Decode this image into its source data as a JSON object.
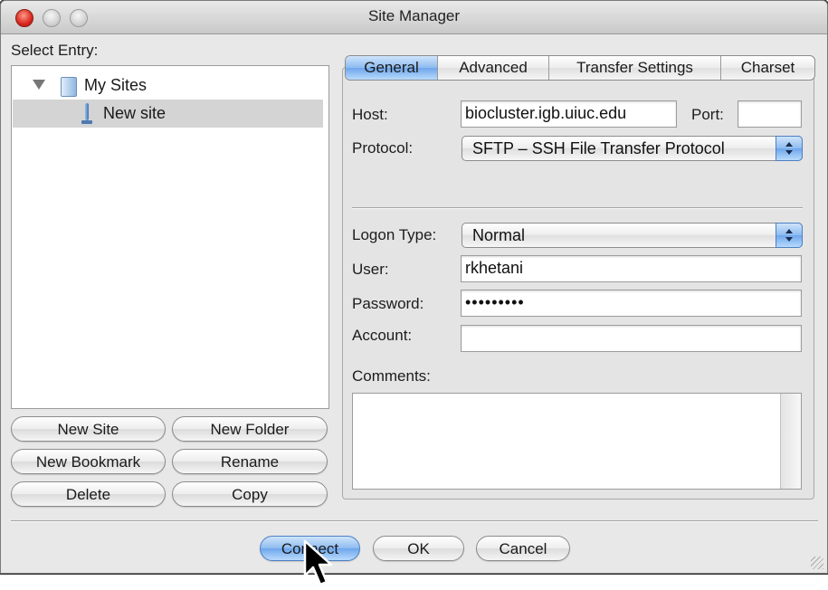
{
  "window": {
    "title": "Site Manager"
  },
  "left": {
    "select_entry_label": "Select Entry:",
    "tree": [
      {
        "label": "My Sites",
        "type": "folder",
        "expanded": true,
        "icon": "folder-icon"
      },
      {
        "label": "New site",
        "type": "site",
        "selected": true,
        "icon": "site-icon"
      }
    ],
    "buttons": {
      "new_site": "New Site",
      "new_folder": "New Folder",
      "new_bookmark": "New Bookmark",
      "rename": "Rename",
      "delete": "Delete",
      "copy": "Copy"
    }
  },
  "tabs": [
    {
      "label": "General",
      "active": true
    },
    {
      "label": "Advanced",
      "active": false
    },
    {
      "label": "Transfer Settings",
      "active": false
    },
    {
      "label": "Charset",
      "active": false
    }
  ],
  "general": {
    "host_label": "Host:",
    "host_value": "biocluster.igb.uiuc.edu",
    "port_label": "Port:",
    "port_value": "",
    "protocol_label": "Protocol:",
    "protocol_value": "SFTP – SSH File Transfer Protocol",
    "logon_type_label": "Logon Type:",
    "logon_type_value": "Normal",
    "user_label": "User:",
    "user_value": "rkhetani",
    "password_label": "Password:",
    "password_value": "•••••••••",
    "account_label": "Account:",
    "account_value": "",
    "comments_label": "Comments:",
    "comments_value": ""
  },
  "footer": {
    "connect": "Connect",
    "ok": "OK",
    "cancel": "Cancel"
  },
  "colors": {
    "accent_blue": "#8dbbf0",
    "window_bg": "#e8e8e8",
    "close_red": "#d8261c"
  }
}
